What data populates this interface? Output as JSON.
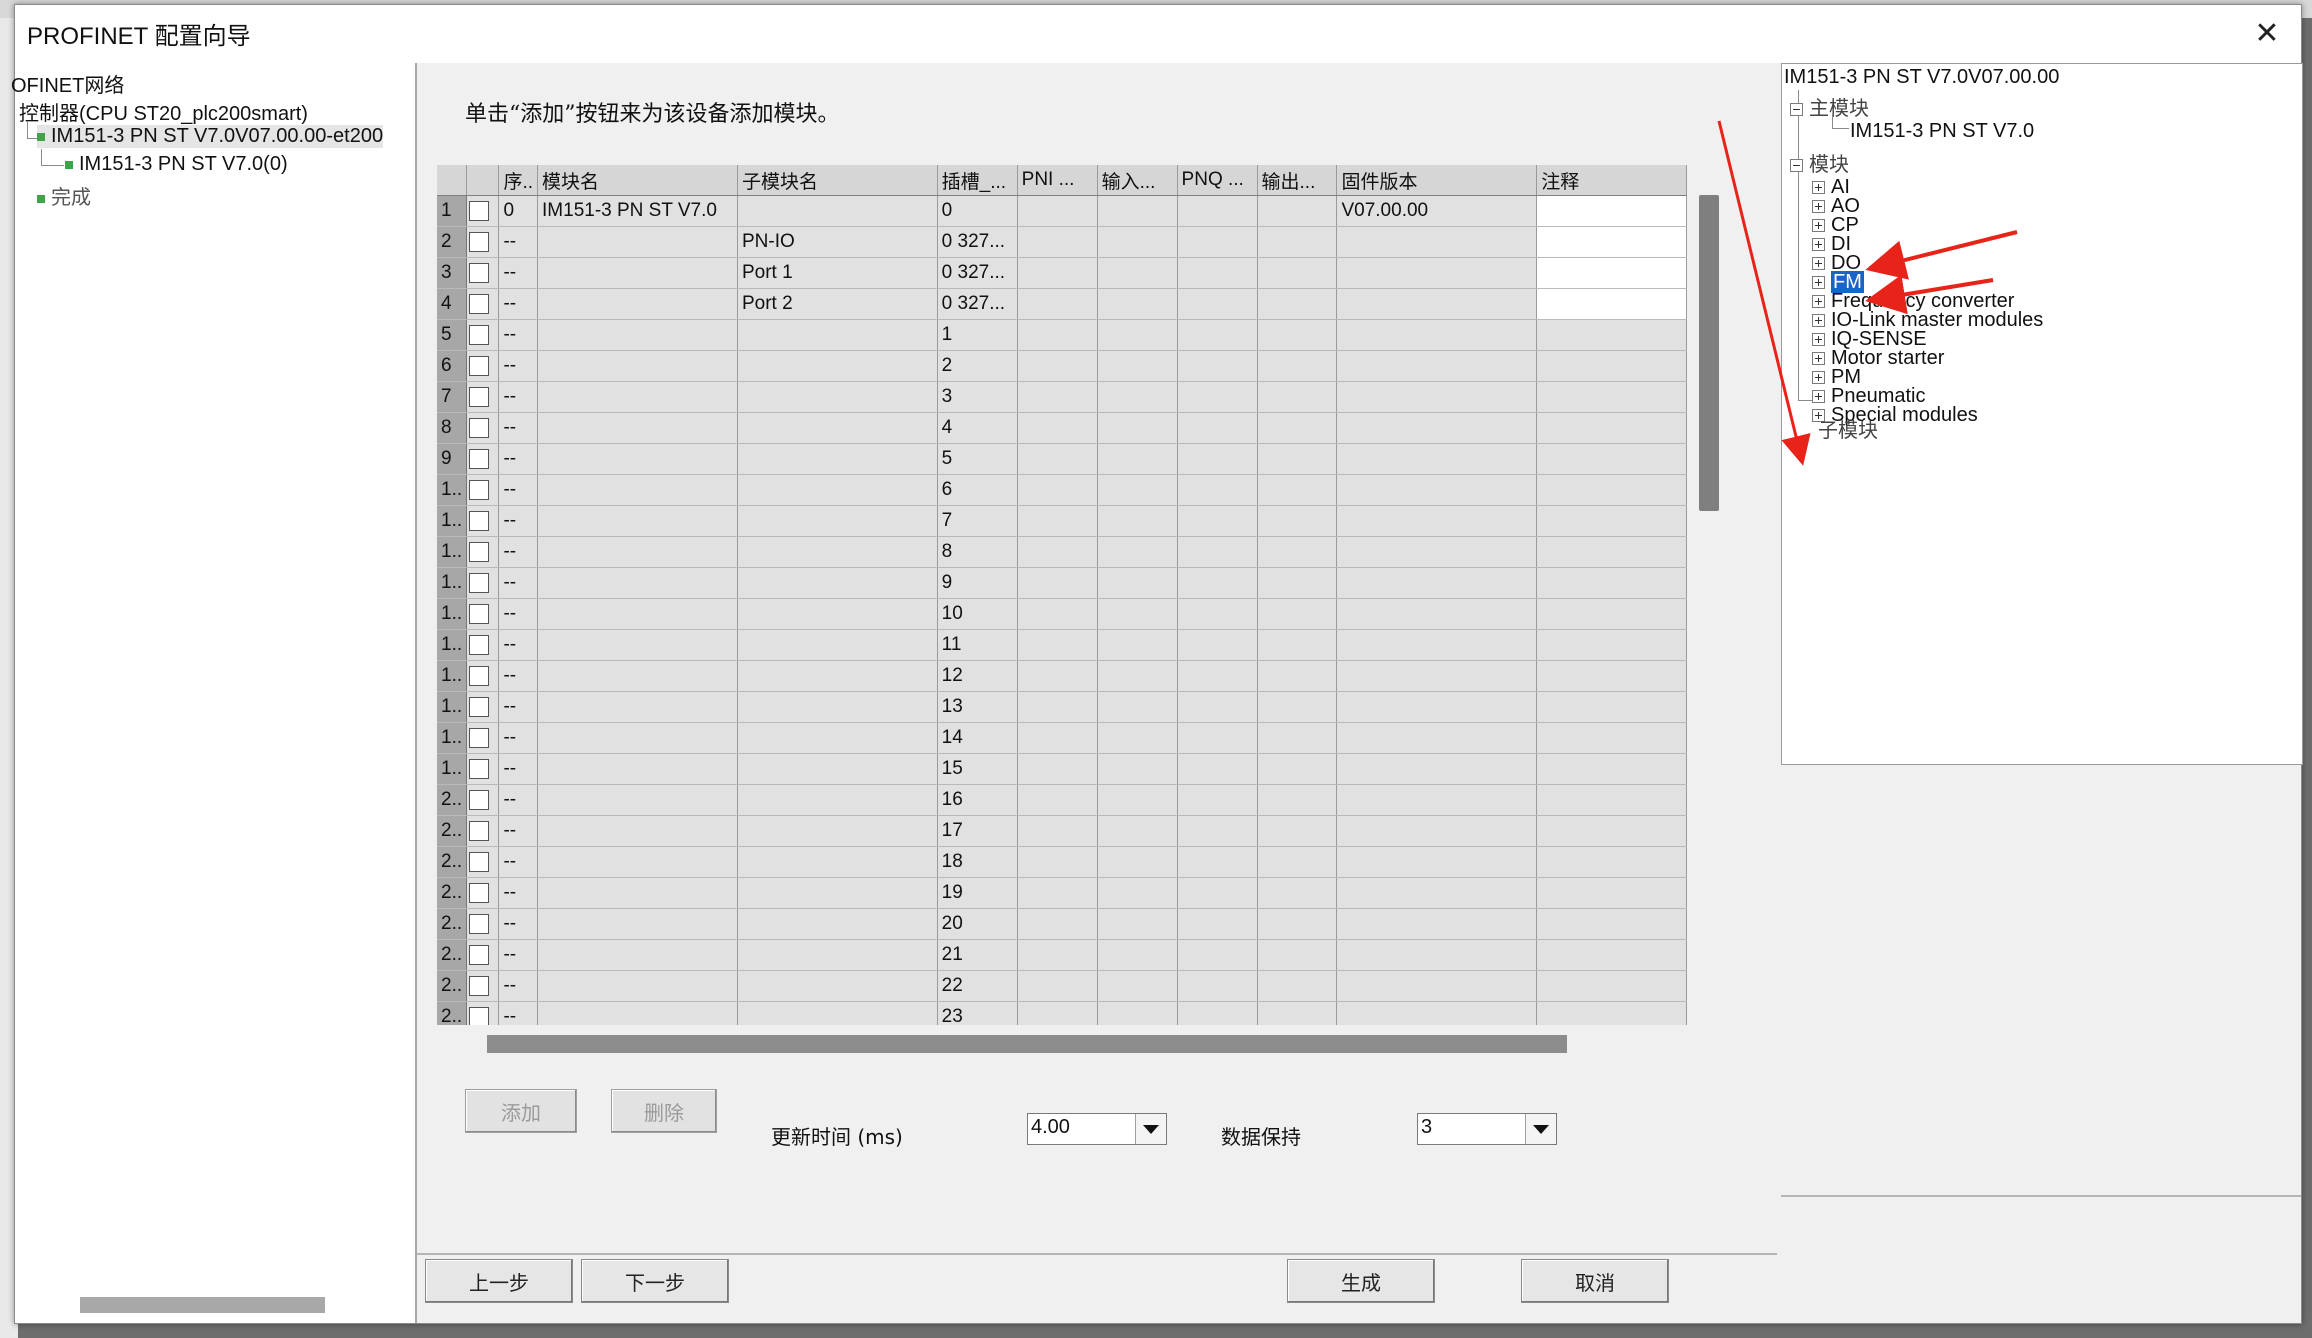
{
  "dialog": {
    "title": "PROFINET 配置向导"
  },
  "left_tree": {
    "items": [
      {
        "label": "OFINET网络"
      },
      {
        "label": "控制器(CPU ST20_plc200smart)"
      },
      {
        "label": "IM151-3 PN ST V7.0V07.00.00-et200"
      },
      {
        "label": "IM151-3 PN ST V7.0(0)"
      },
      {
        "label": "完成"
      }
    ]
  },
  "main": {
    "instruction": "单击“添加”按钮来为该设备添加模块。",
    "columns": [
      "序..",
      "模块名",
      "子模块名",
      "插槽_...",
      "PNI ...",
      "输入...",
      "PNQ ...",
      "输出...",
      "固件版本",
      "注释"
    ],
    "rows": [
      {
        "num": "1",
        "seq": "0",
        "module": "IM151-3 PN ST V7.0",
        "submodule": "",
        "slot": "0",
        "firmware": "V07.00.00"
      },
      {
        "num": "2",
        "seq": "--",
        "module": "",
        "submodule": "PN-IO",
        "slot": "0 327...",
        "firmware": ""
      },
      {
        "num": "3",
        "seq": "--",
        "module": "",
        "submodule": "Port 1",
        "slot": "0 327...",
        "firmware": ""
      },
      {
        "num": "4",
        "seq": "--",
        "module": "",
        "submodule": "Port 2",
        "slot": "0 327...",
        "firmware": ""
      },
      {
        "num": "5",
        "seq": "--",
        "module": "",
        "submodule": "",
        "slot": "1",
        "firmware": ""
      },
      {
        "num": "6",
        "seq": "--",
        "module": "",
        "submodule": "",
        "slot": "2",
        "firmware": ""
      },
      {
        "num": "7",
        "seq": "--",
        "module": "",
        "submodule": "",
        "slot": "3",
        "firmware": ""
      },
      {
        "num": "8",
        "seq": "--",
        "module": "",
        "submodule": "",
        "slot": "4",
        "firmware": ""
      },
      {
        "num": "9",
        "seq": "--",
        "module": "",
        "submodule": "",
        "slot": "5",
        "firmware": ""
      },
      {
        "num": "1..",
        "seq": "--",
        "module": "",
        "submodule": "",
        "slot": "6",
        "firmware": ""
      },
      {
        "num": "1..",
        "seq": "--",
        "module": "",
        "submodule": "",
        "slot": "7",
        "firmware": ""
      },
      {
        "num": "1..",
        "seq": "--",
        "module": "",
        "submodule": "",
        "slot": "8",
        "firmware": ""
      },
      {
        "num": "1..",
        "seq": "--",
        "module": "",
        "submodule": "",
        "slot": "9",
        "firmware": ""
      },
      {
        "num": "1..",
        "seq": "--",
        "module": "",
        "submodule": "",
        "slot": "10",
        "firmware": ""
      },
      {
        "num": "1..",
        "seq": "--",
        "module": "",
        "submodule": "",
        "slot": "11",
        "firmware": ""
      },
      {
        "num": "1..",
        "seq": "--",
        "module": "",
        "submodule": "",
        "slot": "12",
        "firmware": ""
      },
      {
        "num": "1..",
        "seq": "--",
        "module": "",
        "submodule": "",
        "slot": "13",
        "firmware": ""
      },
      {
        "num": "1..",
        "seq": "--",
        "module": "",
        "submodule": "",
        "slot": "14",
        "firmware": ""
      },
      {
        "num": "1..",
        "seq": "--",
        "module": "",
        "submodule": "",
        "slot": "15",
        "firmware": ""
      },
      {
        "num": "2..",
        "seq": "--",
        "module": "",
        "submodule": "",
        "slot": "16",
        "firmware": ""
      },
      {
        "num": "2..",
        "seq": "--",
        "module": "",
        "submodule": "",
        "slot": "17",
        "firmware": ""
      },
      {
        "num": "2..",
        "seq": "--",
        "module": "",
        "submodule": "",
        "slot": "18",
        "firmware": ""
      },
      {
        "num": "2..",
        "seq": "--",
        "module": "",
        "submodule": "",
        "slot": "19",
        "firmware": ""
      },
      {
        "num": "2..",
        "seq": "--",
        "module": "",
        "submodule": "",
        "slot": "20",
        "firmware": ""
      },
      {
        "num": "2..",
        "seq": "--",
        "module": "",
        "submodule": "",
        "slot": "21",
        "firmware": ""
      },
      {
        "num": "2..",
        "seq": "--",
        "module": "",
        "submodule": "",
        "slot": "22",
        "firmware": ""
      },
      {
        "num": "2..",
        "seq": "--",
        "module": "",
        "submodule": "",
        "slot": "23",
        "firmware": ""
      }
    ],
    "add_button": "添加",
    "delete_button": "删除",
    "update_time_label": "更新时间 (ms)",
    "update_time_value": "4.00",
    "data_hold_label": "数据保持",
    "data_hold_value": "3"
  },
  "catalog": {
    "root": "IM151-3 PN ST V7.0V07.00.00",
    "main_module_label": "主模块",
    "main_module_item": "IM151-3 PN ST V7.0",
    "modules_label": "模块",
    "module_items": [
      "AI",
      "AO",
      "CP",
      "DI",
      "DO",
      "FM",
      "Frequency converter",
      "IO-Link master modules",
      "IQ-SENSE",
      "Motor starter",
      "PM",
      "Pneumatic",
      "Special modules"
    ],
    "selected_item": "FM",
    "submodules_label": "子模块"
  },
  "footer": {
    "prev_button": "上一步",
    "next_button": "下一步",
    "generate_button": "生成",
    "cancel_button": "取消"
  },
  "colors": {
    "selection": "#1a63c8",
    "annotation_arrow": "#e8231a",
    "tree_status": "#3fa447"
  }
}
